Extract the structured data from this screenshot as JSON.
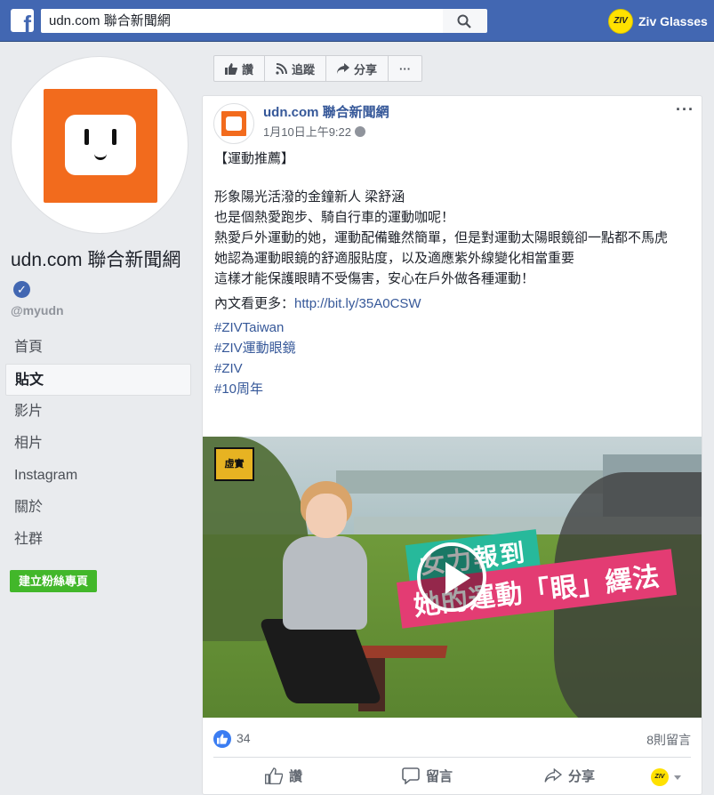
{
  "topbar": {
    "logo_letter": "f",
    "search_value": "udn.com 聯合新聞網",
    "user_name": "Ziv Glasses",
    "user_avatar_text": "ZIV",
    "brand_color": "#4267b2"
  },
  "page": {
    "name": "udn.com 聯合新聞網",
    "handle": "@myudn",
    "verified_mark": "✓",
    "avatar_color": "#f26b1d",
    "nav": [
      "首頁",
      "貼文",
      "影片",
      "相片",
      "Instagram",
      "關於",
      "社群"
    ],
    "active_nav": "貼文",
    "create_button": "建立粉絲專頁"
  },
  "actionbar": {
    "like": "讚",
    "follow": "追蹤",
    "share": "分享",
    "more": "···"
  },
  "post": {
    "author": "udn.com 聯合新聞網",
    "timestamp": "1月10日上午9:22",
    "more_icon": "···",
    "heading": "【運動推薦】",
    "lines": [
      "形象陽光活潑的金鐘新人 梁舒涵",
      "也是個熱愛跑步、騎自行車的運動咖呢！",
      "熱愛戶外運動的她，運動配備雖然簡單，但是對運動太陽眼鏡卻一點都不馬虎",
      "她認為運動眼鏡的舒適服貼度，以及適應紫外線變化相當重要",
      "這樣才能保護眼睛不受傷害，安心在戶外做各種運動！"
    ],
    "link_prefix": "內文看更多：",
    "link": "http://bit.ly/35A0CSW",
    "hashtags": [
      "#ZIVTaiwan",
      "#ZIV運動眼鏡",
      "#ZIV",
      "#10周年"
    ],
    "video": {
      "badge": "虛實",
      "title_top": "女力報到",
      "title_bottom": "她的運動「眼」繹法",
      "play_icon": "play-icon"
    },
    "likes": "34",
    "comments": "8則留言",
    "actions": {
      "like": "讚",
      "comment": "留言",
      "share": "分享"
    },
    "page_avatar_text": "ZIV"
  }
}
